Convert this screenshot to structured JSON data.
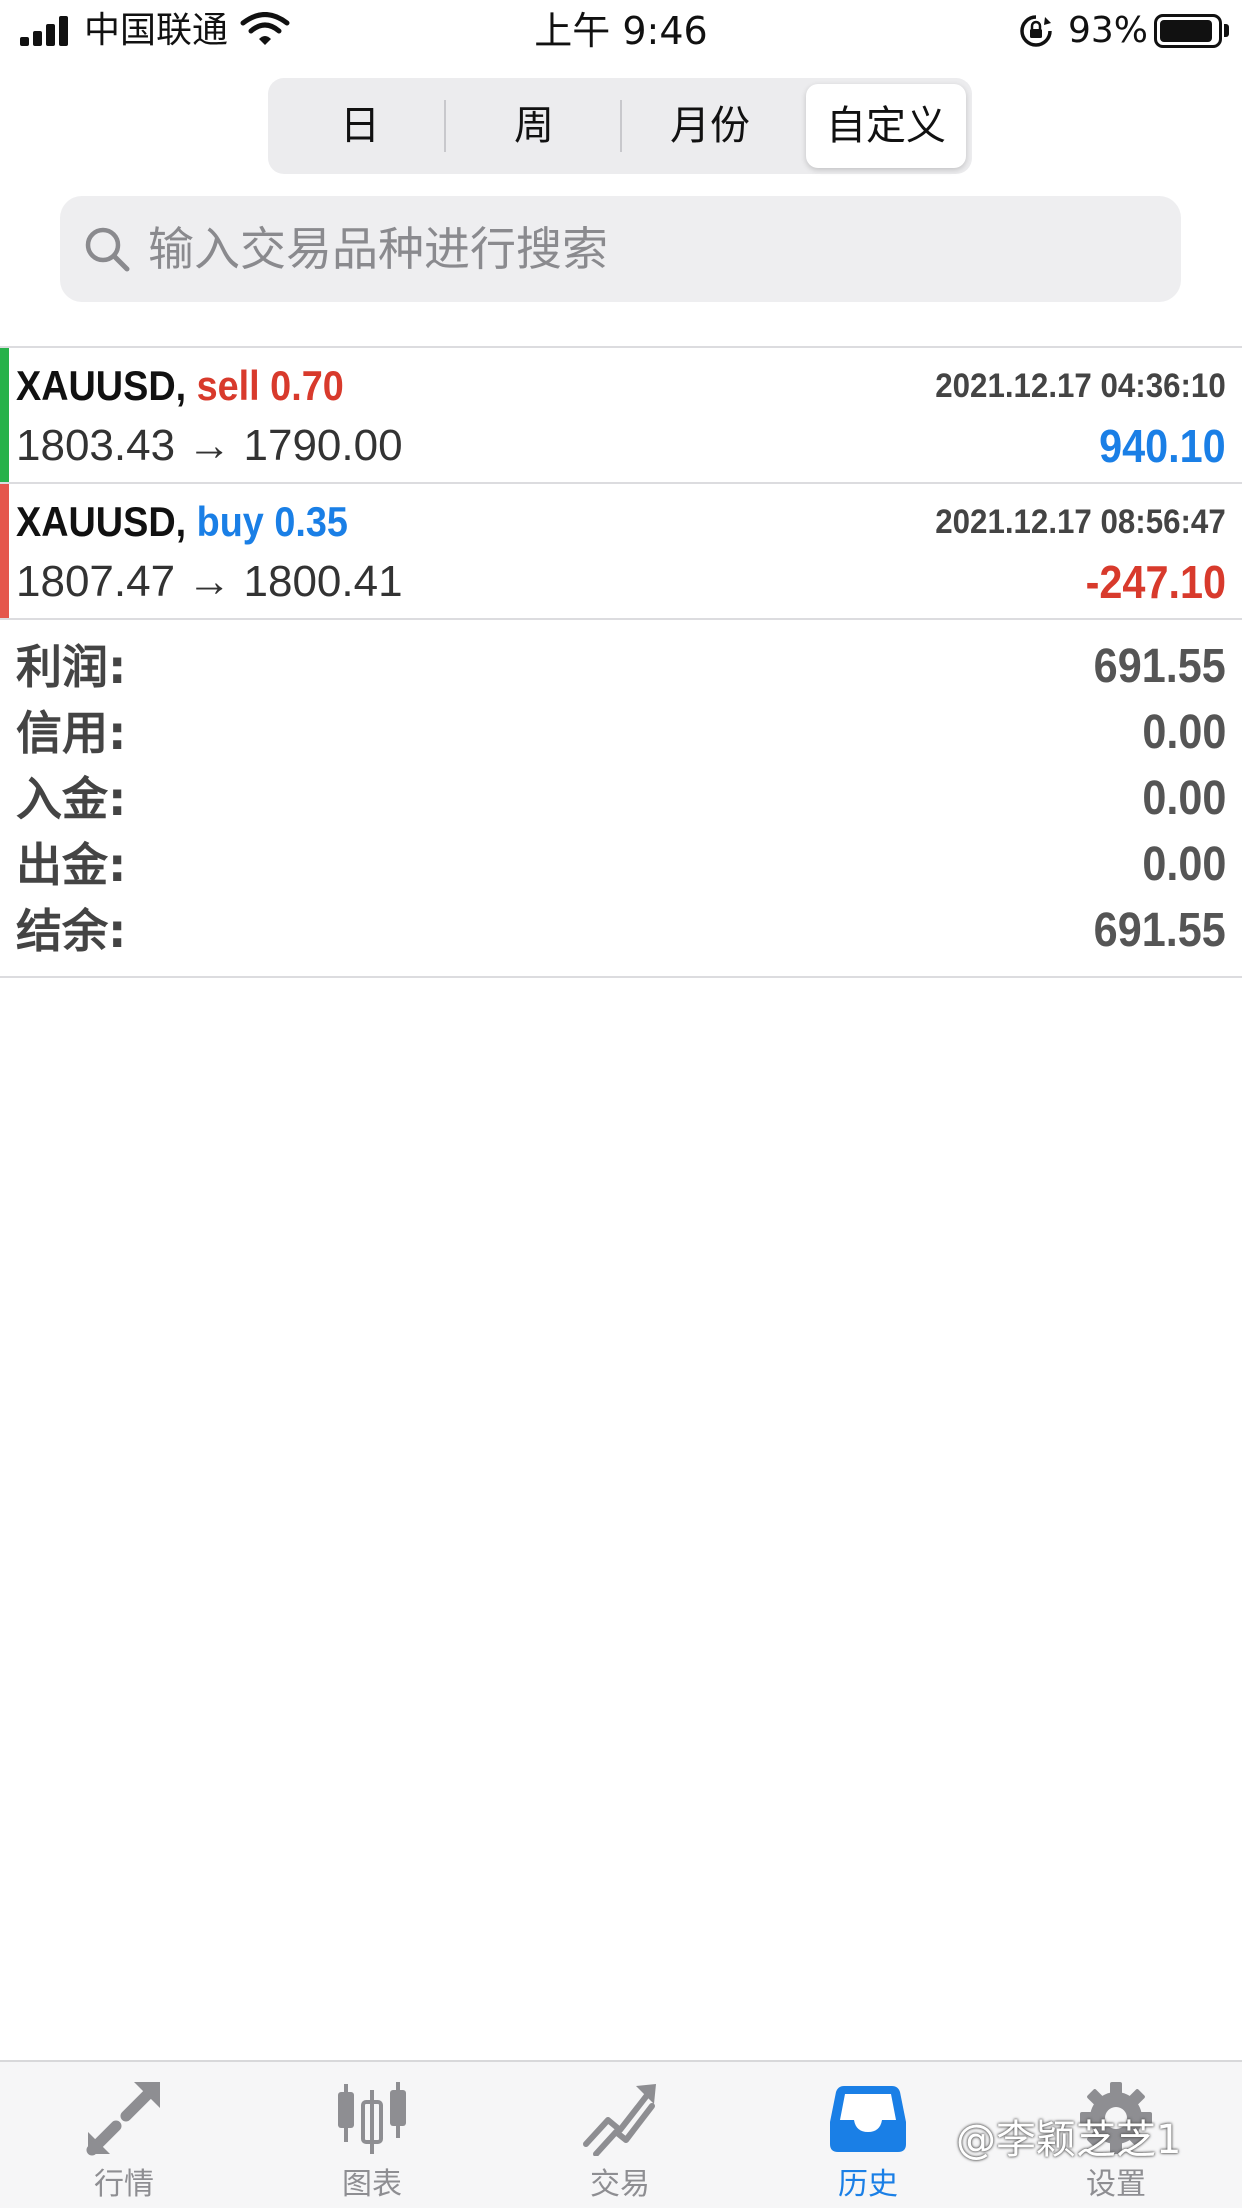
{
  "status_bar": {
    "carrier": "中国联通",
    "time": "上午 9:46",
    "battery": "93%",
    "battery_level": 0.93
  },
  "period_tabs": [
    {
      "label": "日",
      "active": false
    },
    {
      "label": "周",
      "active": false
    },
    {
      "label": "月份",
      "active": false
    },
    {
      "label": "自定义",
      "active": true
    }
  ],
  "search": {
    "placeholder": "输入交易品种进行搜索",
    "value": ""
  },
  "deals": [
    {
      "symbol": "XAUUSD,",
      "action": "sell 0.70",
      "time": "2021.12.17 04:36:10",
      "prices": "1803.43 → 1790.00",
      "profit": "940.10",
      "bar_color": "#27b24a",
      "action_color": "#d83a2c",
      "profit_color": "#1a7fe6"
    },
    {
      "symbol": "XAUUSD,",
      "action": "buy 0.35",
      "time": "2021.12.17 08:56:47",
      "prices": "1807.47 → 1800.41",
      "profit": "-247.10",
      "bar_color": "#e5574c",
      "action_color": "#1a7fe6",
      "profit_color": "#d83a2c"
    }
  ],
  "summary": [
    {
      "label": "利润:",
      "value": "691.55"
    },
    {
      "label": "信用:",
      "value": "0.00"
    },
    {
      "label": "入金:",
      "value": "0.00"
    },
    {
      "label": "出金:",
      "value": "0.00"
    },
    {
      "label": "结余:",
      "value": "691.55"
    }
  ],
  "tab_bar": [
    {
      "label": "行情",
      "icon": "quotes-arrows-icon",
      "active": false
    },
    {
      "label": "图表",
      "icon": "candlestick-chart-icon",
      "active": false
    },
    {
      "label": "交易",
      "icon": "trade-trend-icon",
      "active": false
    },
    {
      "label": "历史",
      "icon": "history-inbox-icon",
      "active": true
    },
    {
      "label": "设置",
      "icon": "gear-icon",
      "active": false
    }
  ],
  "watermark": "@李颖芝芝1",
  "colors": {
    "accent": "#1a7fe6",
    "loss": "#d83a2c",
    "profit_bar": "#27b24a",
    "loss_bar": "#e5574c"
  }
}
